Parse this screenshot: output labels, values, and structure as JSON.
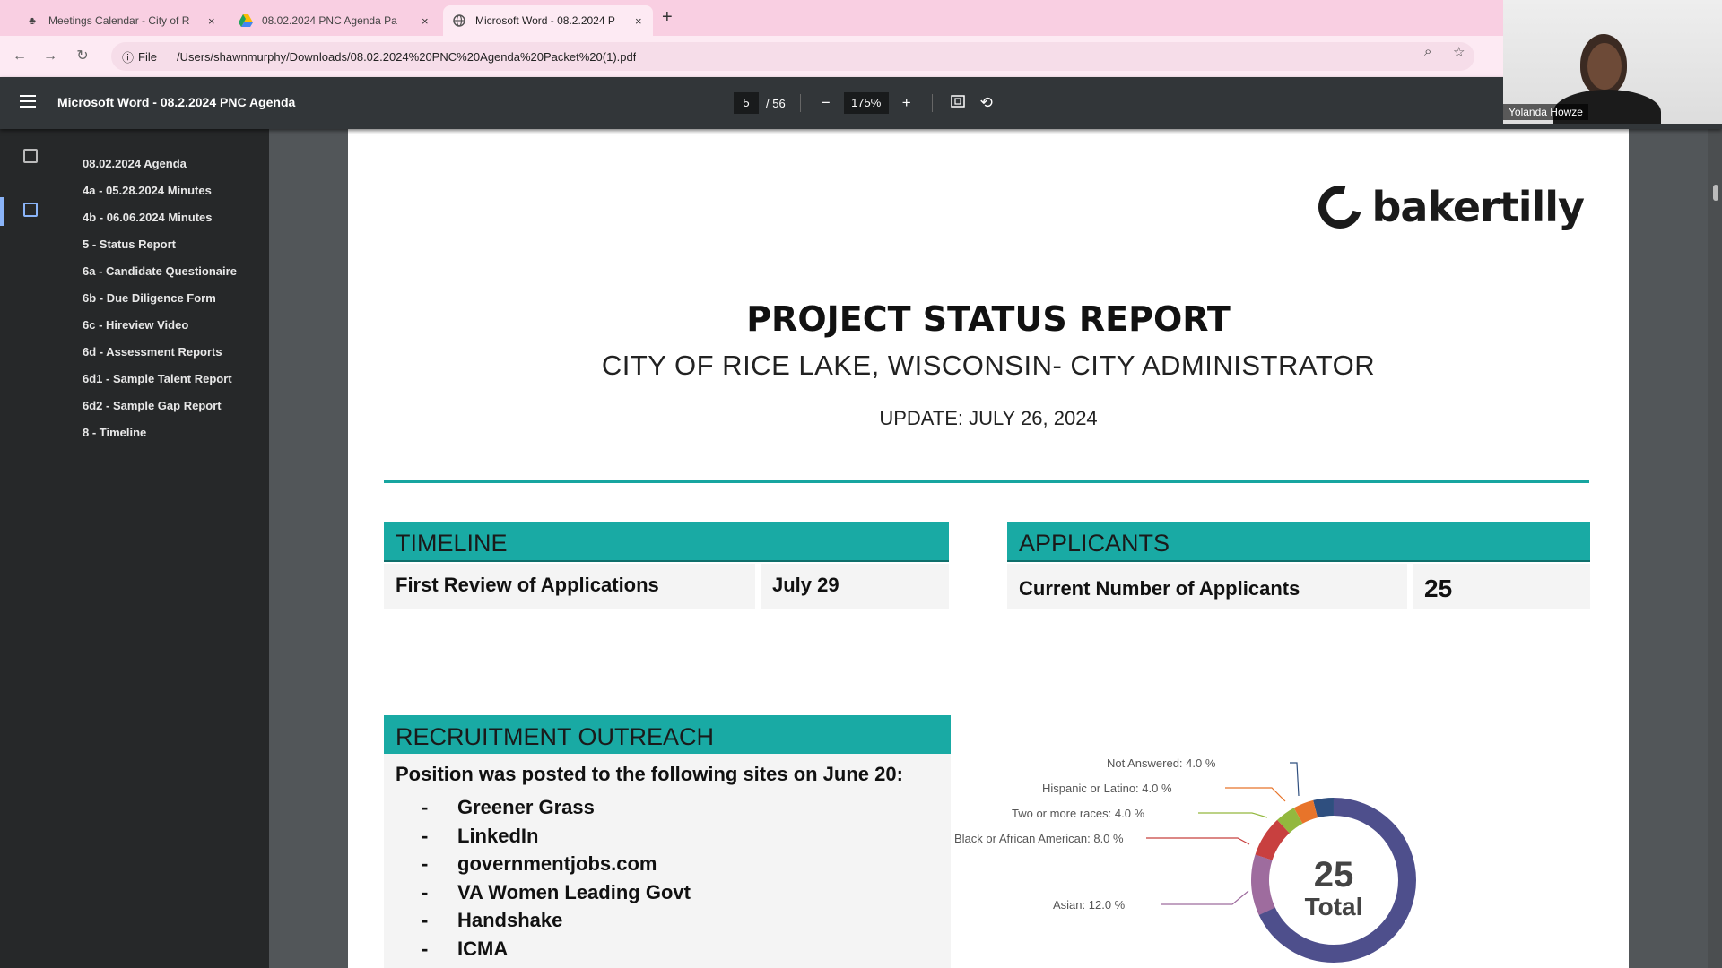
{
  "browser": {
    "tabs": [
      {
        "title": "Meetings Calendar - City of R",
        "icon": "city-favicon",
        "active": false
      },
      {
        "title": "08.02.2024 PNC Agenda Pa",
        "icon": "google-drive-favicon",
        "active": false
      },
      {
        "title": "Microsoft Word - 08.2.2024 P",
        "icon": "globe-favicon",
        "active": true
      }
    ],
    "new_tab": "+",
    "close": "×",
    "omnibox": {
      "chip_label": "File",
      "url": "/Users/shawnmurphy/Downloads/08.02.2024%20PNC%20Agenda%20Packet%20(1).pdf"
    }
  },
  "pdf_toolbar": {
    "title": "Microsoft Word - 08.2.2024 PNC Agenda",
    "current_page": "5",
    "total_pages": "/ 56",
    "zoom": "175%",
    "zoom_out": "−",
    "zoom_in": "+"
  },
  "webcam": {
    "participant_name": "Yolanda Howze"
  },
  "outline": [
    "08.02.2024 Agenda",
    "4a - 05.28.2024 Minutes",
    "4b - 06.06.2024 Minutes",
    "5 - Status Report",
    "6a - Candidate Questionaire",
    "6b - Due Diligence Form",
    "6c - Hireview Video",
    "6d - Assessment Reports",
    "6d1 - Sample Talent Report",
    "6d2 - Sample Gap Report",
    "8 - Timeline"
  ],
  "document": {
    "logo_text": "bakertilly",
    "title": "PROJECT STATUS REPORT",
    "subtitle": "CITY OF RICE LAKE, WISCONSIN- CITY ADMINISTRATOR",
    "update": "UPDATE: JULY 26, 2024",
    "accent_color": "#19aaa4",
    "timeline": {
      "heading": "TIMELINE",
      "label": "First Review of Applications",
      "value": "July 29"
    },
    "applicants": {
      "heading": "APPLICANTS",
      "label": "Current Number of Applicants",
      "value": "25"
    },
    "outreach": {
      "heading": "RECRUITMENT OUTREACH",
      "lead": "Position was posted to the following sites on June 20:",
      "bullet": "-",
      "sites": [
        "Greener Grass",
        "LinkedIn",
        "governmentjobs.com",
        "VA Women Leading Govt",
        "Handshake",
        "ICMA"
      ]
    },
    "donut": {
      "total_value": "25",
      "total_label": "Total",
      "slices": [
        {
          "label": "Not Answered: 4.0 %",
          "percent": 4.0,
          "color": "#2f4f7f"
        },
        {
          "label": "Hispanic or Latino: 4.0 %",
          "percent": 4.0,
          "color": "#e8742a"
        },
        {
          "label": "Two or more races: 4.0 %",
          "percent": 4.0,
          "color": "#93b83e"
        },
        {
          "label": "Black or African American: 8.0 %",
          "percent": 8.0,
          "color": "#c8403f"
        },
        {
          "label": "Asian: 12.0 %",
          "percent": 12.0,
          "color": "#9e6c9e"
        }
      ],
      "remainder_color": "#4e4f8c"
    }
  }
}
